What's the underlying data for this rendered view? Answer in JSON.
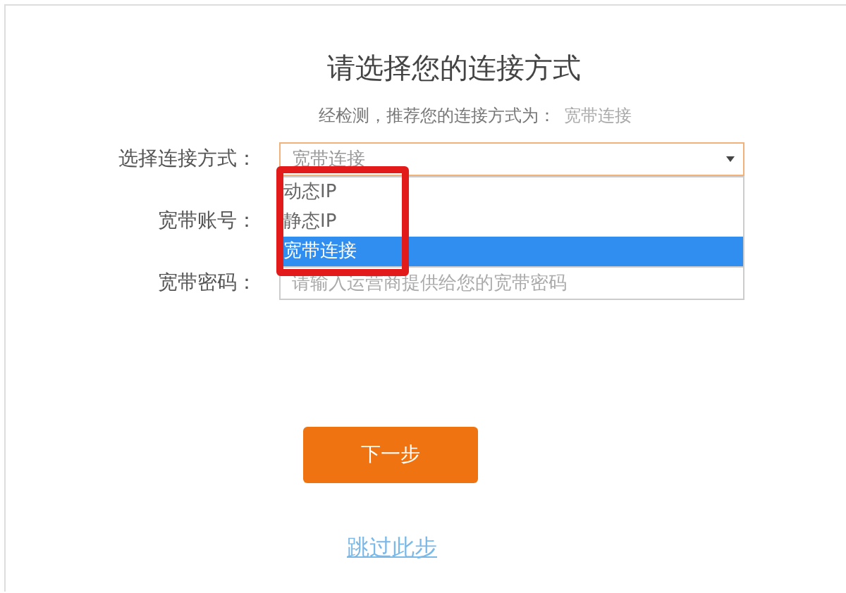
{
  "title": "请选择您的连接方式",
  "recommendation": {
    "label": "经检测，推荐您的连接方式为：",
    "value": "宽带连接"
  },
  "fields": [
    {
      "kind": "select",
      "label": "选择连接方式：",
      "value": "宽带连接",
      "expanded": true,
      "options": [
        {
          "label": "动态IP",
          "selected": false
        },
        {
          "label": "静态IP",
          "selected": false
        },
        {
          "label": "宽带连接",
          "selected": true
        }
      ]
    },
    {
      "kind": "text",
      "label": "宽带账号："
    },
    {
      "kind": "password",
      "label": "宽带密码：",
      "placeholder": "请输入运营商提供给您的宽带密码"
    }
  ],
  "next_button": "下一步",
  "skip_link": "跳过此步"
}
